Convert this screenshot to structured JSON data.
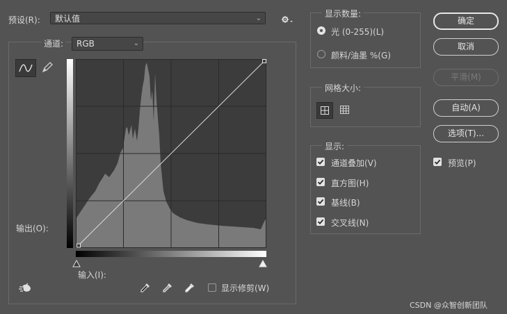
{
  "preset": {
    "label": "预设(R):",
    "value": "默认值"
  },
  "channel": {
    "label": "通道:",
    "value": "RGB"
  },
  "output_label": "输出(O):",
  "input_label": "输入(I):",
  "show_clipping": {
    "label": "显示修剪(W)",
    "checked": false
  },
  "display_amount": {
    "legend": "显示数量:",
    "options": [
      {
        "label": "光 (0-255)(L)",
        "selected": true
      },
      {
        "label": "颜料/油墨 %(G)",
        "selected": false
      }
    ]
  },
  "grid_size": {
    "legend": "网格大小:"
  },
  "display": {
    "legend": "显示:",
    "options": [
      {
        "label": "通道叠加(V)",
        "checked": true
      },
      {
        "label": "直方图(H)",
        "checked": true
      },
      {
        "label": "基线(B)",
        "checked": true
      },
      {
        "label": "交叉线(N)",
        "checked": true
      }
    ]
  },
  "buttons": {
    "ok": "确定",
    "cancel": "取消",
    "smooth": "平滑(M)",
    "auto": "自动(A)",
    "options": "选项(T)..."
  },
  "preview": {
    "label": "预览(P)",
    "checked": true
  },
  "watermark": "CSDN @众智创新团队",
  "colors": {
    "background": "#535353",
    "histogram": "#7a7a7a",
    "curve": "#dcdcdc"
  },
  "icons": [
    "curve-mode-icon",
    "pencil-icon",
    "target-adjust-icon",
    "black-eyedropper-icon",
    "gray-eyedropper-icon",
    "white-eyedropper-icon",
    "settings-gear-icon",
    "grid-4-icon",
    "grid-10-icon"
  ]
}
